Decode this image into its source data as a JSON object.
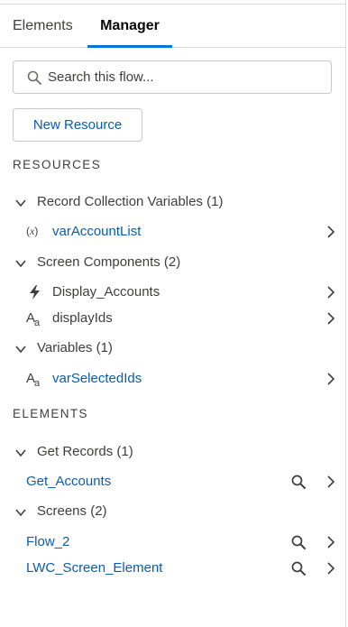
{
  "tabs": [
    {
      "label": "Elements",
      "active": false
    },
    {
      "label": "Manager",
      "active": true
    }
  ],
  "search": {
    "placeholder": "Search this flow..."
  },
  "new_resource_label": "New Resource",
  "resources_heading": "RESOURCES",
  "resources": [
    {
      "label": "Record Collection Variables (1)",
      "items": [
        {
          "label": "varAccountList",
          "icon": "variable-icon",
          "link": true
        }
      ]
    },
    {
      "label": "Screen Components (2)",
      "items": [
        {
          "label": "Display_Accounts",
          "icon": "lightning-bolt-icon",
          "link": false
        },
        {
          "label": "displayIds",
          "icon": "text-format-icon",
          "link": false
        }
      ]
    },
    {
      "label": "Variables (1)",
      "items": [
        {
          "label": "varSelectedIds",
          "icon": "text-format-icon",
          "link": true
        }
      ]
    }
  ],
  "elements_heading": "ELEMENTS",
  "elements": [
    {
      "label": "Get Records (1)",
      "items": [
        {
          "label": "Get_Accounts"
        }
      ]
    },
    {
      "label": "Screens (2)",
      "items": [
        {
          "label": "Flow_2"
        },
        {
          "label": "LWC_Screen_Element"
        }
      ]
    }
  ],
  "colors": {
    "accent": "#0176d3",
    "link": "#0b5cab",
    "text": "#3e3e3c",
    "border": "#dddbda"
  }
}
